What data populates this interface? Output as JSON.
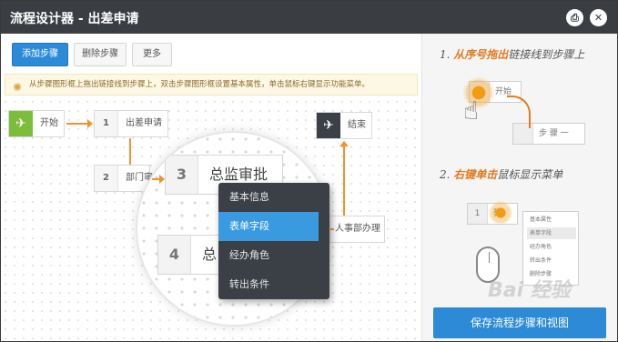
{
  "window": {
    "title": "流程设计器 - 出差申请",
    "print_icon": "print-icon",
    "close_icon": "close-icon"
  },
  "toolbar": {
    "add_step": "添加步骤",
    "delete_step": "删除步骤",
    "more": "更多"
  },
  "notice": {
    "icon": "lightbulb-icon",
    "text": "从步骤图形框上拖出链接线到步骤上，双击步骤图形框设置基本属性，单击鼠标右键显示功能菜单。"
  },
  "flow": {
    "start": "开始",
    "end": "结束",
    "nodes": [
      {
        "num": "1",
        "label": "出差申请"
      },
      {
        "num": "2",
        "label": "部门审"
      },
      {
        "num": "3",
        "label": "总监审批"
      },
      {
        "num": "4",
        "label": "总"
      },
      {
        "num": "",
        "label": "人事部办理"
      }
    ]
  },
  "context_menu": {
    "items": [
      "基本信息",
      "表单字段",
      "经办角色",
      "转出条件"
    ],
    "active_index": 1
  },
  "guide": {
    "step1_num": "1.",
    "step1_em": "从序号拖出",
    "step1_rest": "链接线到步骤上",
    "step1_start": "开始",
    "step1_node": "步 骤 一",
    "step2_num": "2.",
    "step2_em": "右键单击",
    "step2_rest": "鼠标显示菜单",
    "step2_node_num": "1",
    "step2_node": "骤",
    "mini_menu": [
      "基本属性",
      "表单字段",
      "经办角色",
      "转出条件",
      "删除步骤"
    ]
  },
  "save_button": "保存流程步骤和视图",
  "watermark": "Bai 经验"
}
